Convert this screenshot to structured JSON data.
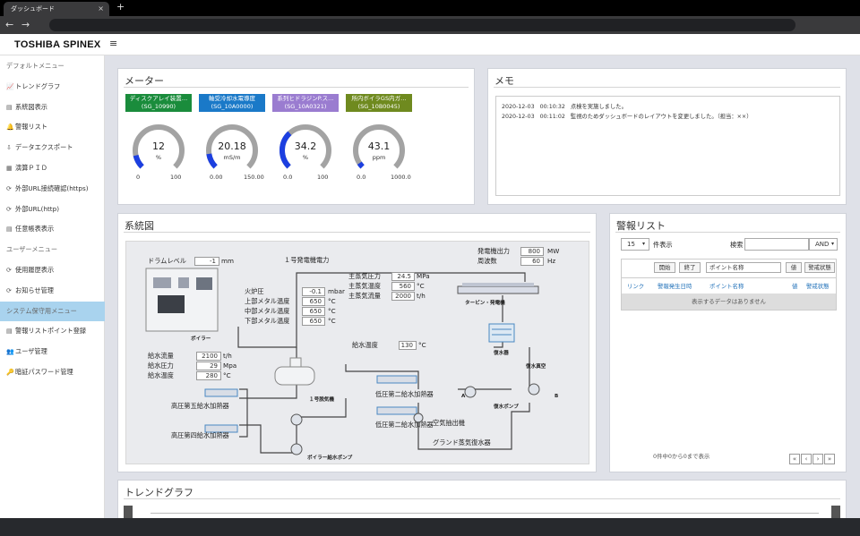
{
  "browser": {
    "tab_title": "ダッシュボード",
    "tab_close": "×",
    "new_tab": "+",
    "back": "←",
    "forward": "→"
  },
  "app": {
    "logo": "TOSHIBA SPINEX",
    "menu_icon": "≡"
  },
  "sidebar": {
    "items": [
      {
        "label": "デフォルトメニュー",
        "section": true
      },
      {
        "label": "トレンドグラフ",
        "icon": "📈"
      },
      {
        "label": "系統図表示",
        "icon": "▤"
      },
      {
        "label": "警報リスト",
        "icon": "🔔"
      },
      {
        "label": "データエクスポート",
        "icon": "⇩"
      },
      {
        "label": "演算ＰＩＤ",
        "icon": "▦"
      },
      {
        "label": "外部URL接続確認(https)",
        "icon": "⟳"
      },
      {
        "label": "外部URL(http)",
        "icon": "⟳"
      },
      {
        "label": "任意帳表表示",
        "icon": "▤"
      },
      {
        "label": "ユーザーメニュー",
        "section": true
      },
      {
        "label": "使用履歴表示",
        "icon": "⟳"
      },
      {
        "label": "お知らせ管理",
        "icon": "⟳"
      },
      {
        "label": "システム保守用メニュー",
        "section": true,
        "active": true
      },
      {
        "label": "警報リストポイント登録",
        "icon": "▤"
      },
      {
        "label": "ユーザ管理",
        "icon": "👥"
      },
      {
        "label": "暗証パスワード管理",
        "icon": "🔑"
      }
    ]
  },
  "meter_panel": {
    "title": "メーター",
    "meters": [
      {
        "tag_line1": "ディスクアレイ装置…",
        "tag_line2": "(SG_10990)",
        "color": "#1a8c3c",
        "value": "12",
        "unit": "%",
        "min": "0",
        "max": "100",
        "fraction": 0.12
      },
      {
        "tag_line1": "軸受冷却水電導度",
        "tag_line2": "(SG_10A0000)",
        "color": "#1a79c8",
        "value": "20.18",
        "unit": "mS/m",
        "min": "0.00",
        "max": "150.00",
        "fraction": 0.1345
      },
      {
        "tag_line1": "系列ヒドラジンP.ス…",
        "tag_line2": "(SG_10A0321)",
        "color": "#9a7cd0",
        "value": "34.2",
        "unit": "%",
        "min": "0.0",
        "max": "100",
        "fraction": 0.342
      },
      {
        "tag_line1": "所内ボイラGS内ガ…",
        "tag_line2": "(SG_10B0045)",
        "color": "#6f8a1f",
        "value": "43.1",
        "unit": "ppm",
        "min": "0.0",
        "max": "1000.0",
        "fraction": 0.0431
      }
    ],
    "gauge_fill": "#1c3fe0"
  },
  "memo_panel": {
    "title": "メモ",
    "entries": [
      {
        "date": "2020-12-03",
        "time": "00:10:32",
        "text": "点検を実施しました。"
      },
      {
        "date": "2020-12-03",
        "time": "00:11:02",
        "text": "監視のためダッシュボードのレイアウトを変更しました。（担当：××）"
      }
    ]
  },
  "system_panel": {
    "title": "系統図",
    "drum_level_label": "ドラムレベル",
    "drum_level_value": "-1",
    "drum_level_unit": "mm",
    "gen_power_label": "１号発電機電力",
    "gen_output_label": "発電機出力",
    "gen_output_value": "800",
    "gen_output_unit": "MW",
    "freq_label": "周波数",
    "freq_value": "60",
    "freq_unit": "Hz",
    "main_steam_p_label": "主蒸気圧力",
    "main_steam_p_value": "24.5",
    "main_steam_p_unit": "MPa",
    "main_steam_t_label": "主蒸気温度",
    "main_steam_t_value": "560",
    "main_steam_t_unit": "°C",
    "main_steam_f_label": "主蒸気流量",
    "main_steam_f_value": "2000",
    "main_steam_f_unit": "t/h",
    "furnace_p_label": "火炉圧",
    "furnace_p_value": "-0.1",
    "furnace_p_unit": "mbar",
    "upper_metal_label": "上部メタル温度",
    "upper_metal_value": "650",
    "upper_metal_unit": "°C",
    "mid_metal_label": "中部メタル温度",
    "mid_metal_value": "650",
    "mid_metal_unit": "°C",
    "low_metal_label": "下部メタル温度",
    "low_metal_value": "650",
    "low_metal_unit": "°C",
    "boiler_label": "ボイラー",
    "turbine_label": "タービン・発電機",
    "condenser_label": "復水器",
    "feedwater_temp_label": "給水温度",
    "feedwater_temp_value": "130",
    "feedwater_temp_unit": "°C",
    "fw_flow_label": "給水流量",
    "fw_flow_value": "2100",
    "fw_flow_unit": "t/h",
    "fw_pressure_label": "給水圧力",
    "fw_pressure_value": "29",
    "fw_pressure_unit": "Mpa",
    "fw_temp_label": "給水温度",
    "fw_temp_value": "280",
    "fw_temp_unit": "°C",
    "hp5_label": "高圧第五給水加熱器",
    "hp4_label": "高圧第四給水加熱器",
    "deaerator_label": "１号脱気機",
    "lp2a_label": "低圧第二給水加熱器",
    "lp2b_label": "低圧第二給水加熱器",
    "air_ext_label": "空気抽出機",
    "gland_label": "グランド蒸気復水器",
    "fw_pump_label": "ボイラー給水ポンプ",
    "cond_pump_label": "復水ポンプ",
    "vacuum_label": "復水真空",
    "pump_a": "A",
    "pump_b": "B"
  },
  "alarm_panel": {
    "title": "警報リスト",
    "page_size": "15",
    "page_size_suffix": "件表示",
    "search_label": "検索",
    "search_mode": "AND",
    "filter_start": "開始",
    "filter_end": "終了",
    "filter_point": "ポイント名称",
    "filter_value": "値",
    "filter_state": "警戒状態",
    "col_link": "リンク",
    "col_time": "警報発生日時",
    "col_point": "ポイント名称",
    "col_value": "値",
    "col_state": "警戒状態",
    "empty": "表示するデータはありません",
    "summary": "0件中0から0まで表示",
    "pager": [
      "«",
      "‹",
      "›",
      "»"
    ]
  },
  "trend_panel": {
    "title": "トレンドグラフ"
  }
}
